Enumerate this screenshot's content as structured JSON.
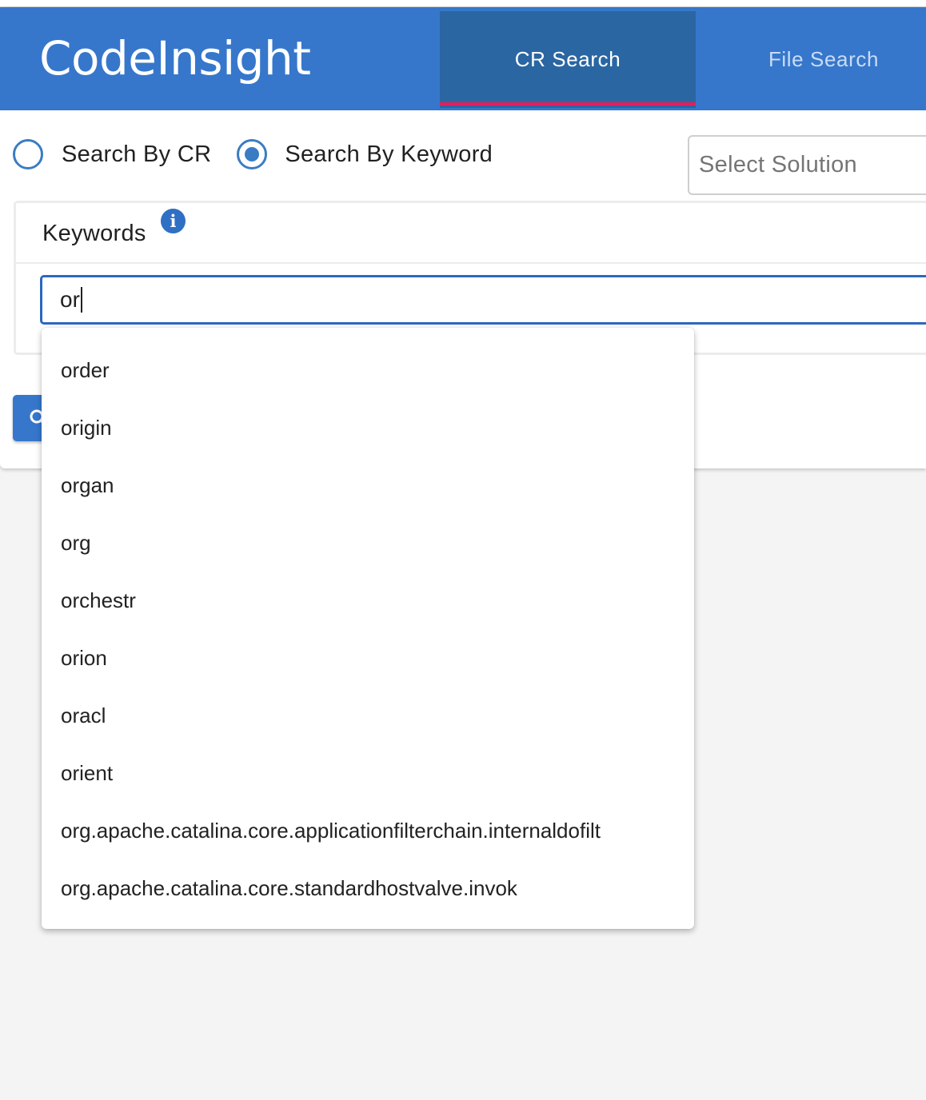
{
  "app": {
    "brand": "CodeInsight",
    "tabs": [
      {
        "label": "CR Search",
        "active": true
      },
      {
        "label": "File Search",
        "active": false
      }
    ]
  },
  "search_mode": {
    "options": [
      {
        "label": "Search By CR",
        "selected": false
      },
      {
        "label": "Search By Keyword",
        "selected": true
      }
    ]
  },
  "solution_select": {
    "placeholder": "Select Solution"
  },
  "keywords": {
    "title": "Keywords",
    "info_icon": "info-icon",
    "input_value": "or"
  },
  "suggestions": [
    "order",
    "origin",
    "organ",
    "org",
    "orchestr",
    "orion",
    "oracl",
    "orient",
    "org.apache.catalina.core.applicationfilterchain.internaldofilt",
    "org.apache.catalina.core.standardhostvalve.invok"
  ],
  "colors": {
    "brand_blue": "#3677cc",
    "active_tab": "#2a66a2",
    "tab_indicator": "#e51d5d",
    "focus_border": "#2c68bd"
  }
}
